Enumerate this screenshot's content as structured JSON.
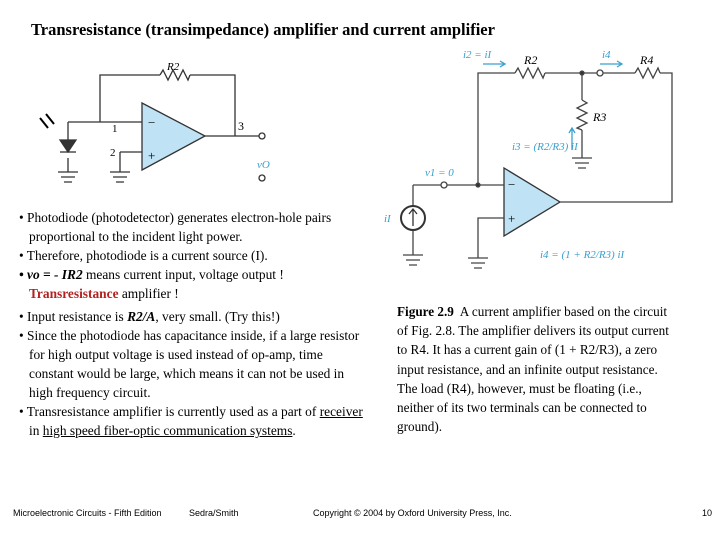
{
  "title": "Transresistance (transimpedance) amplifier and current amplifier",
  "bullets": {
    "b1": "• Photodiode (photodetector) generates electron-hole pairs proportional to the incident light power.",
    "b2": "• Therefore, photodiode is a current source (I).",
    "b3a": "• vo = - IR2",
    "b3b": " means current input, voltage output ! ",
    "b3c": "Transresistance",
    "b3d": " amplifier !",
    "b4a": "• Input resistance is ",
    "b4b": "R2/A",
    "b4c": ", very small. (Try this!)",
    "b5": "• Since the photodiode has capacitance inside, if a large resistor for high output voltage is used instead of op-amp, time constant would be large, which means it can not be used in high frequency circuit.",
    "b6a": "• Transresistance amplifier is currently used as a part of ",
    "b6b": "receiver",
    "b6c": " in ",
    "b6d": "high speed fiber-optic communication systems",
    "b6e": "."
  },
  "left_circuit": {
    "r2": "R2",
    "pin1": "1",
    "pin2": "2",
    "pin3": "3",
    "minus": "−",
    "plus": "+",
    "vo": "vO"
  },
  "right_circuit": {
    "i2": "i2 = iI",
    "r2": "R2",
    "i4": "i4",
    "r4": "R4",
    "r3": "R3",
    "i3": "i3 = (R2/R3) iI",
    "v1": "v1 = 0",
    "ii": "iI",
    "i4eq": "i4 = (1 + R2/R3) iI",
    "minus": "−",
    "plus": "+"
  },
  "caption": {
    "label": "Figure 2.9",
    "text": "A current amplifier based on the circuit of Fig. 2.8. The amplifier delivers its output current to R4. It has a current gain of (1 + R2/R3), a zero input resistance, and an infinite output resistance. The load (R4), however, must be floating (i.e., neither of its two terminals can be connected to ground)."
  },
  "footer": {
    "book": "Microelectronic Circuits - Fifth Edition",
    "authors": "Sedra/Smith",
    "copyright": "Copyright © 2004 by Oxford University Press, Inc.",
    "page": "10"
  },
  "colors": {
    "accent_red": "#b22222",
    "annotation_blue": "#3aa0d0",
    "opamp_fill": "#bfe3f5"
  }
}
